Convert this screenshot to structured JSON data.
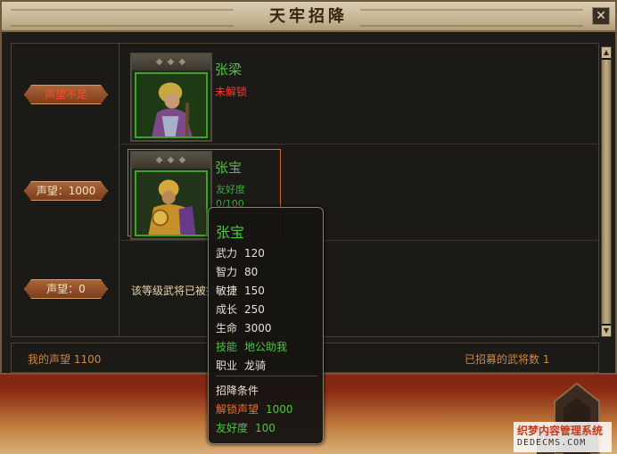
{
  "window": {
    "title": "天牢招降",
    "close_label": "✕"
  },
  "rows": [
    {
      "reputation_badge": "声望不足",
      "hero_name": "张梁",
      "hero_status": "未解锁"
    },
    {
      "reputation_badge": "声望：1000",
      "hero_name": "张宝",
      "friendship_label": "友好度",
      "friendship_value": "0/100"
    },
    {
      "reputation_badge": "声望：0",
      "info_text": "该等级武将已被招"
    }
  ],
  "footer": {
    "my_reputation": "我的声望 1100",
    "recruited_count": "已招募的武将数 1"
  },
  "tooltip": {
    "name": "张宝",
    "stats": [
      {
        "label": "武力",
        "value": "120"
      },
      {
        "label": "智力",
        "value": "80"
      },
      {
        "label": "敏捷",
        "value": "150"
      },
      {
        "label": "成长",
        "value": "250"
      },
      {
        "label": "生命",
        "value": "3000"
      }
    ],
    "skill": {
      "label": "技能",
      "value": "地公助我"
    },
    "job": {
      "label": "职业",
      "value": "龙骑"
    },
    "conditions_title": "招降条件",
    "unlock_rep": {
      "label": "解锁声望",
      "value": "1000"
    },
    "friendship": {
      "label": "友好度",
      "value": "100"
    }
  },
  "watermark": {
    "line1": "织梦内容管理系统",
    "line2": "DEDECMS.COM"
  },
  "colors": {
    "hero_name": "#47c83b",
    "locked": "#ff3a2a",
    "accent_orange": "#d4863a",
    "badge_bg": "#7d3e1c"
  }
}
